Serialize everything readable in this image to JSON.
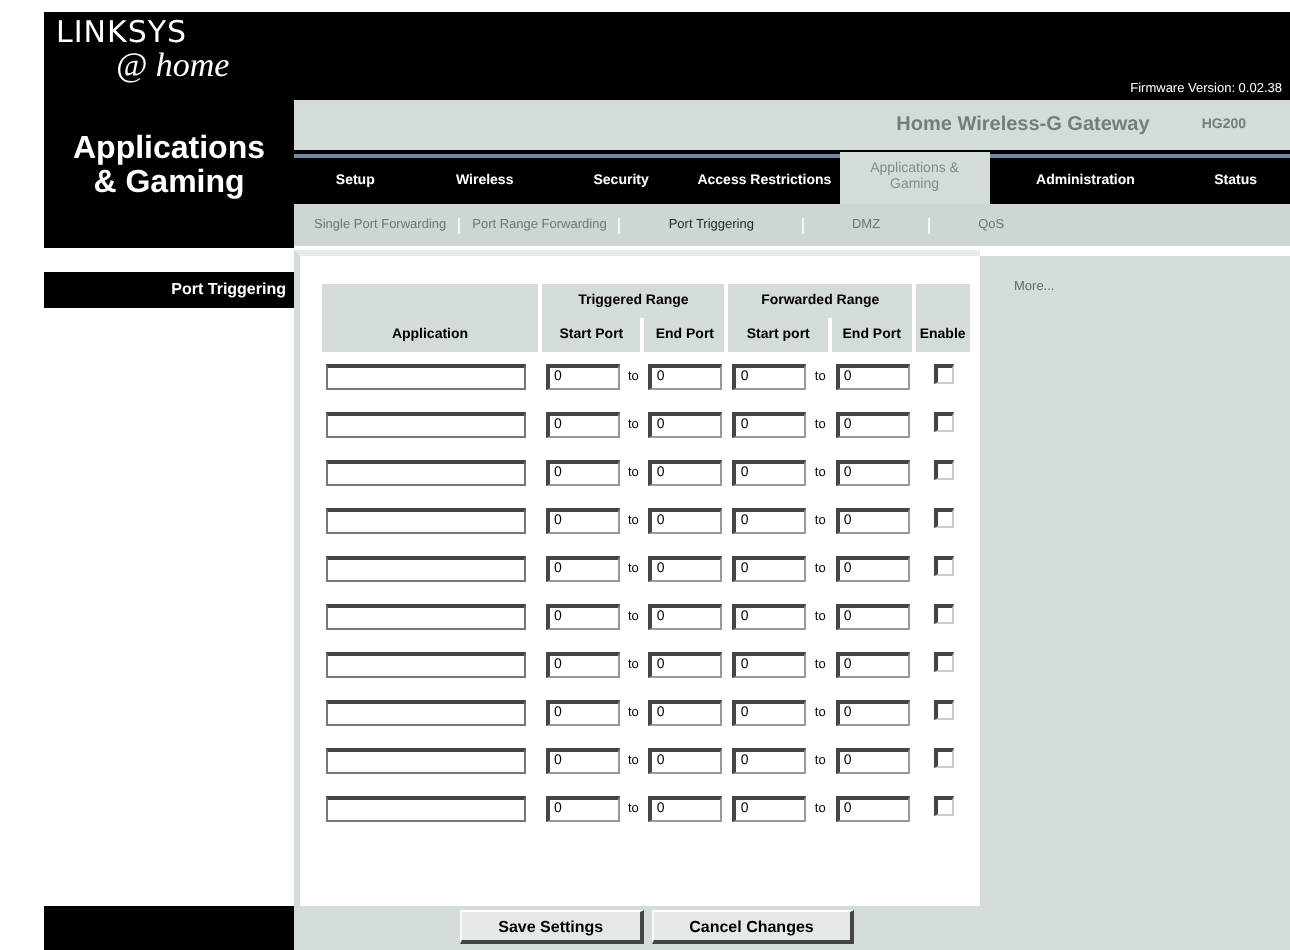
{
  "logo": {
    "brand": "LINKSYS",
    "tagline": "@ home"
  },
  "firmware": "Firmware Version: 0.02.38",
  "product": {
    "name": "Home Wireless-G Gateway",
    "model": "HG200"
  },
  "section_title": "Applications & Gaming",
  "tabs": [
    {
      "label": "Setup",
      "selected": false
    },
    {
      "label": "Wireless",
      "selected": false
    },
    {
      "label": "Security",
      "selected": false
    },
    {
      "label": "Access Restrictions",
      "selected": false
    },
    {
      "label": "Applications & Gaming",
      "selected": true
    },
    {
      "label": "Administration",
      "selected": false
    },
    {
      "label": "Status",
      "selected": false
    }
  ],
  "subtabs": [
    {
      "label": "Single Port Forwarding",
      "selected": false
    },
    {
      "label": "Port Range Forwarding",
      "selected": false
    },
    {
      "label": "Port Triggering",
      "selected": true
    },
    {
      "label": "DMZ",
      "selected": false
    },
    {
      "label": "QoS",
      "selected": false
    }
  ],
  "sidebar_label": "Port Triggering",
  "table": {
    "groups": [
      "Triggered Range",
      "Forwarded Range"
    ],
    "columns": [
      "Application",
      "Start Port",
      "End Port",
      "Start port",
      "End Port",
      "Enable"
    ],
    "rows": [
      {
        "application": "",
        "trig_start": "0",
        "trig_to": "to",
        "trig_end": "0",
        "fwd_start": "0",
        "fwd_to": "to",
        "fwd_end": "0",
        "enabled": false
      },
      {
        "application": "",
        "trig_start": "0",
        "trig_to": "to",
        "trig_end": "0",
        "fwd_start": "0",
        "fwd_to": "to",
        "fwd_end": "0",
        "enabled": false
      },
      {
        "application": "",
        "trig_start": "0",
        "trig_to": "to",
        "trig_end": "0",
        "fwd_start": "0",
        "fwd_to": "to",
        "fwd_end": "0",
        "enabled": false
      },
      {
        "application": "",
        "trig_start": "0",
        "trig_to": "to",
        "trig_end": "0",
        "fwd_start": "0",
        "fwd_to": "to",
        "fwd_end": "0",
        "enabled": false
      },
      {
        "application": "",
        "trig_start": "0",
        "trig_to": "to",
        "trig_end": "0",
        "fwd_start": "0",
        "fwd_to": "to",
        "fwd_end": "0",
        "enabled": false
      },
      {
        "application": "",
        "trig_start": "0",
        "trig_to": "to",
        "trig_end": "0",
        "fwd_start": "0",
        "fwd_to": "to",
        "fwd_end": "0",
        "enabled": false
      },
      {
        "application": "",
        "trig_start": "0",
        "trig_to": "to",
        "trig_end": "0",
        "fwd_start": "0",
        "fwd_to": "to",
        "fwd_end": "0",
        "enabled": false
      },
      {
        "application": "",
        "trig_start": "0",
        "trig_to": "to",
        "trig_end": "0",
        "fwd_start": "0",
        "fwd_to": "to",
        "fwd_end": "0",
        "enabled": false
      },
      {
        "application": "",
        "trig_start": "0",
        "trig_to": "to",
        "trig_end": "0",
        "fwd_start": "0",
        "fwd_to": "to",
        "fwd_end": "0",
        "enabled": false
      },
      {
        "application": "",
        "trig_start": "0",
        "trig_to": "to",
        "trig_end": "0",
        "fwd_start": "0",
        "fwd_to": "to",
        "fwd_end": "0",
        "enabled": false
      }
    ]
  },
  "more_link": "More...",
  "buttons": [
    "Save Settings",
    "Cancel Changes"
  ]
}
